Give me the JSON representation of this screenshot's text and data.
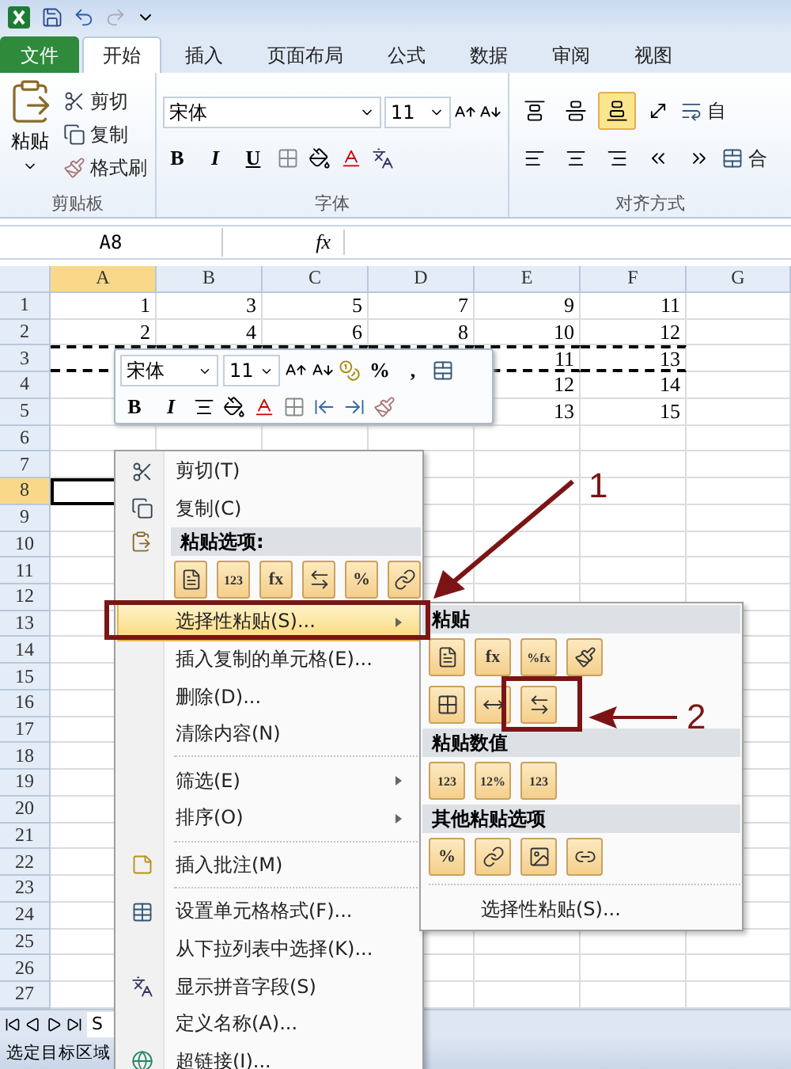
{
  "ribbon_tabs": [
    {
      "label": "文件",
      "kind": "file",
      "selected": false
    },
    {
      "label": "开始",
      "kind": "tab",
      "selected": true
    },
    {
      "label": "插入",
      "kind": "tab",
      "selected": false
    },
    {
      "label": "页面布局",
      "kind": "tab",
      "selected": false
    },
    {
      "label": "公式",
      "kind": "tab",
      "selected": false
    },
    {
      "label": "数据",
      "kind": "tab",
      "selected": false
    },
    {
      "label": "审阅",
      "kind": "tab",
      "selected": false
    },
    {
      "label": "视图",
      "kind": "tab",
      "selected": false
    }
  ],
  "clipboard_group": {
    "paste": "粘贴",
    "cut": "剪切",
    "copy": "复制",
    "format_painter": "格式刷",
    "label": "剪贴板"
  },
  "font_group": {
    "font": "宋体",
    "size": "11",
    "styles": [
      "B",
      "I",
      "U"
    ],
    "label": "字体"
  },
  "alignment_group": {
    "wrap": "自",
    "merge": "合",
    "bottom_align_selected": true,
    "label": "对齐方式"
  },
  "formula_bar": {
    "name_box": "A8",
    "fx": "fx"
  },
  "sheet": {
    "columns": [
      {
        "label": "A",
        "selected": true
      },
      {
        "label": "B",
        "selected": false
      },
      {
        "label": "C",
        "selected": false
      },
      {
        "label": "D",
        "selected": false
      },
      {
        "label": "E",
        "selected": false
      },
      {
        "label": "F",
        "selected": false
      },
      {
        "label": "G",
        "selected": false
      }
    ],
    "rows": [
      {
        "label": "1",
        "selected": false,
        "copied": false,
        "cells": [
          "1",
          "3",
          "5",
          "7",
          "9",
          "11",
          null
        ]
      },
      {
        "label": "2",
        "selected": false,
        "copied": false,
        "cells": [
          "2",
          "4",
          "6",
          "8",
          "10",
          "12",
          null
        ]
      },
      {
        "label": "3",
        "selected": false,
        "copied": true,
        "cells": [
          null,
          null,
          null,
          null,
          "11",
          "13",
          null
        ]
      },
      {
        "label": "4",
        "selected": false,
        "copied": false,
        "cells": [
          null,
          null,
          null,
          null,
          "12",
          "14",
          null
        ]
      },
      {
        "label": "5",
        "selected": false,
        "copied": false,
        "cells": [
          null,
          null,
          null,
          null,
          "13",
          "15",
          null
        ]
      },
      {
        "label": "6",
        "selected": false,
        "copied": false
      },
      {
        "label": "7",
        "selected": false,
        "copied": false
      },
      {
        "label": "8",
        "selected": true,
        "copied": false
      },
      {
        "label": "9",
        "selected": false,
        "copied": false
      },
      {
        "label": "10",
        "selected": false,
        "copied": false
      },
      {
        "label": "11",
        "selected": false,
        "copied": false
      },
      {
        "label": "12",
        "selected": false,
        "copied": false
      },
      {
        "label": "13",
        "selected": false,
        "copied": false
      },
      {
        "label": "14",
        "selected": false,
        "copied": false
      },
      {
        "label": "15",
        "selected": false,
        "copied": false
      },
      {
        "label": "16",
        "selected": false,
        "copied": false
      },
      {
        "label": "17",
        "selected": false,
        "copied": false
      },
      {
        "label": "18",
        "selected": false,
        "copied": false
      },
      {
        "label": "19",
        "selected": false,
        "copied": false
      },
      {
        "label": "20",
        "selected": false,
        "copied": false
      },
      {
        "label": "21",
        "selected": false,
        "copied": false
      },
      {
        "label": "22",
        "selected": false,
        "copied": false
      },
      {
        "label": "23",
        "selected": false,
        "copied": false
      },
      {
        "label": "24",
        "selected": false,
        "copied": false
      },
      {
        "label": "25",
        "selected": false,
        "copied": false
      },
      {
        "label": "26",
        "selected": false,
        "copied": false
      },
      {
        "label": "27",
        "selected": false,
        "copied": false
      }
    ]
  },
  "sheet_tabs": [
    {
      "label": "S"
    }
  ],
  "status_bar": {
    "text": "选定目标区域"
  },
  "mini_toolbar": {
    "font": "宋体",
    "size": "11",
    "percent": "%",
    "comma": ",",
    "styles": [
      "B",
      "I"
    ]
  },
  "context_menu": {
    "items": [
      {
        "kind": "item",
        "label": "剪切(T)",
        "selected": false,
        "submenu": false
      },
      {
        "kind": "item",
        "label": "复制(C)",
        "selected": false,
        "submenu": false
      },
      {
        "kind": "header",
        "label": "粘贴选项:"
      },
      {
        "kind": "icons",
        "icons": [
          {
            "kind": "document"
          },
          {
            "kind": "text",
            "text": "123"
          },
          {
            "kind": "text",
            "text": "fx"
          },
          {
            "kind": "transpose"
          },
          {
            "kind": "text",
            "text": "%"
          },
          {
            "kind": "link"
          }
        ]
      },
      {
        "kind": "item",
        "label": "选择性粘贴(S)...",
        "selected": true,
        "submenu": true
      },
      {
        "kind": "item",
        "label": "插入复制的单元格(E)...",
        "selected": false,
        "submenu": false
      },
      {
        "kind": "item",
        "label": "删除(D)...",
        "selected": false,
        "submenu": false
      },
      {
        "kind": "item",
        "label": "清除内容(N)",
        "selected": false,
        "submenu": false
      },
      {
        "kind": "separator"
      },
      {
        "kind": "item",
        "label": "筛选(E)",
        "selected": false,
        "submenu": true
      },
      {
        "kind": "item",
        "label": "排序(O)",
        "selected": false,
        "submenu": true
      },
      {
        "kind": "separator"
      },
      {
        "kind": "item",
        "label": "插入批注(M)",
        "selected": false,
        "submenu": false
      },
      {
        "kind": "separator"
      },
      {
        "kind": "item",
        "label": "设置单元格格式(F)...",
        "selected": false,
        "submenu": false
      },
      {
        "kind": "item",
        "label": "从下拉列表中选择(K)...",
        "selected": false,
        "submenu": false
      },
      {
        "kind": "item",
        "label": "显示拼音字段(S)",
        "selected": false,
        "submenu": false
      },
      {
        "kind": "item",
        "label": "定义名称(A)...",
        "selected": false,
        "submenu": false
      },
      {
        "kind": "item",
        "label": "超链接(I)...",
        "selected": false,
        "submenu": false
      }
    ]
  },
  "paste_submenu": {
    "items": [
      {
        "kind": "header",
        "label": "粘贴"
      },
      {
        "kind": "icons",
        "icons": [
          {
            "kind": "document"
          },
          {
            "kind": "text",
            "text": "fx"
          },
          {
            "kind": "text",
            "text": "%fx"
          },
          {
            "kind": "format"
          }
        ]
      },
      {
        "kind": "icons",
        "icons": [
          {
            "kind": "borders"
          },
          {
            "kind": "width"
          },
          {
            "kind": "transpose"
          }
        ]
      },
      {
        "kind": "header",
        "label": "粘贴数值"
      },
      {
        "kind": "icons",
        "icons": [
          {
            "kind": "text",
            "text": "123"
          },
          {
            "kind": "text",
            "text": "12%"
          },
          {
            "kind": "text",
            "text": "123"
          }
        ]
      },
      {
        "kind": "header",
        "label": "其他粘贴选项"
      },
      {
        "kind": "icons",
        "icons": [
          {
            "kind": "text",
            "text": "%"
          },
          {
            "kind": "link"
          },
          {
            "kind": "picture"
          },
          {
            "kind": "linked_picture"
          }
        ]
      },
      {
        "kind": "separator"
      },
      {
        "kind": "item",
        "label": "选择性粘贴(S)..."
      }
    ]
  },
  "annotations": [
    {
      "label": "1"
    },
    {
      "label": "2"
    }
  ]
}
